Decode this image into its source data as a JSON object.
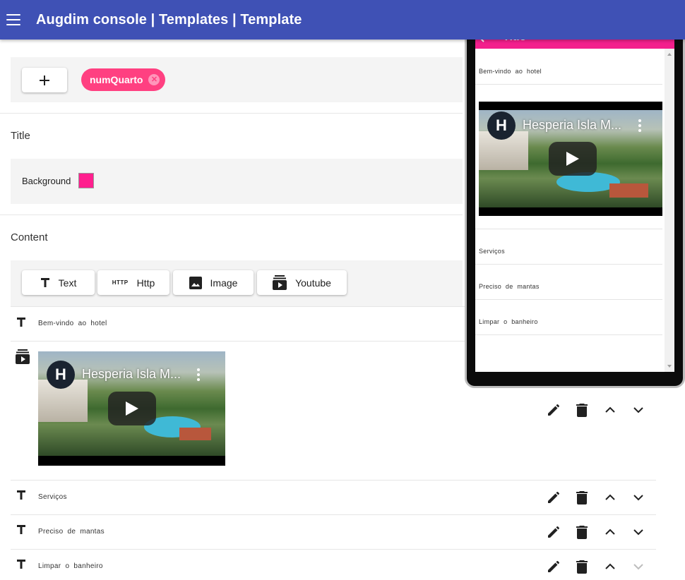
{
  "app": {
    "title": "Augdim console | Templates | Template"
  },
  "variables": {
    "chips": [
      "numQuarto"
    ]
  },
  "title_section": {
    "label": "Title",
    "background_label": "Background",
    "background_color": "#ff1f8e"
  },
  "content_section": {
    "label": "Content",
    "add_buttons": {
      "text": "Text",
      "http_icon": "HTTP",
      "http": "Http",
      "image": "Image",
      "youtube": "Youtube"
    }
  },
  "items": [
    {
      "type": "text",
      "text": "Bem-vindo ao hotel"
    },
    {
      "type": "youtube",
      "video_title": "Hesperia Isla M...",
      "logo_letter": "H"
    },
    {
      "type": "text",
      "text": "Serviços"
    },
    {
      "type": "text",
      "text": "Preciso de mantas"
    },
    {
      "type": "text",
      "text": "Limpar o banheiro"
    }
  ],
  "icons": {
    "menu": "menu-icon",
    "add": "plus-icon",
    "chip_remove": "cancel-icon",
    "text": "format-t-icon",
    "image": "image-icon",
    "youtube": "youtube-icon",
    "edit": "pencil-icon",
    "delete": "trash-icon",
    "up": "chevron-up-icon",
    "down": "chevron-down-icon",
    "back": "arrow-left-icon"
  },
  "preview": {
    "title": "Title",
    "items": [
      "Bem-vindo ao hotel",
      "Serviços",
      "Preciso de mantas",
      "Limpar o banheiro"
    ],
    "video_title": "Hesperia Isla M...",
    "appbar_color": "#f31f8c"
  },
  "colors": {
    "primary": "#3f51b5",
    "accent": "#ff4081"
  }
}
